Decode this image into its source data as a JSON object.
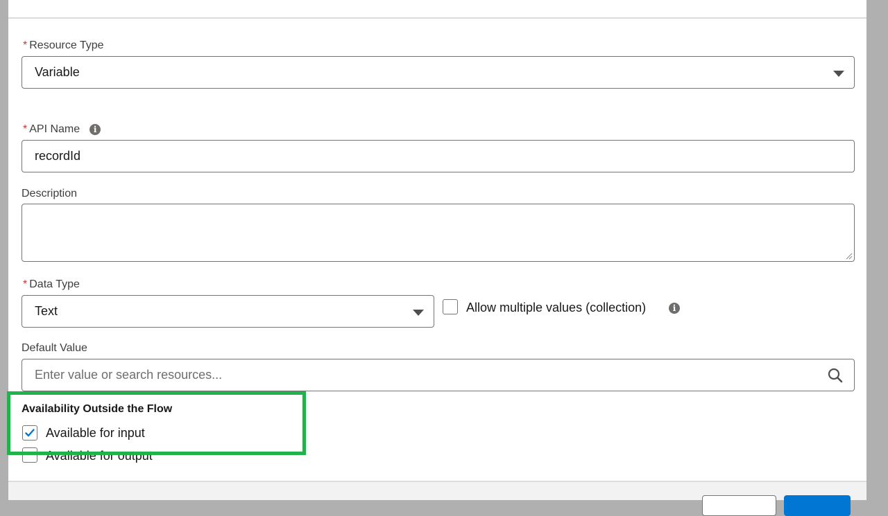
{
  "resource_type": {
    "required_marker": "*",
    "label": "Resource Type",
    "value": "Variable"
  },
  "api_name": {
    "required_marker": "*",
    "label": "API Name",
    "value": "recordId"
  },
  "description": {
    "label": "Description",
    "value": ""
  },
  "data_type": {
    "required_marker": "*",
    "label": "Data Type",
    "value": "Text",
    "allow_multiple_label": "Allow multiple values (collection)",
    "allow_multiple_checked": false
  },
  "default_value": {
    "label": "Default Value",
    "placeholder": "Enter value or search resources..."
  },
  "availability": {
    "title": "Availability Outside the Flow",
    "input_label": "Available for input",
    "input_checked": true,
    "output_label": "Available for output",
    "output_checked": false
  },
  "colors": {
    "highlight": "#22b24c",
    "brand": "#0176d3",
    "required": "#c23934"
  }
}
